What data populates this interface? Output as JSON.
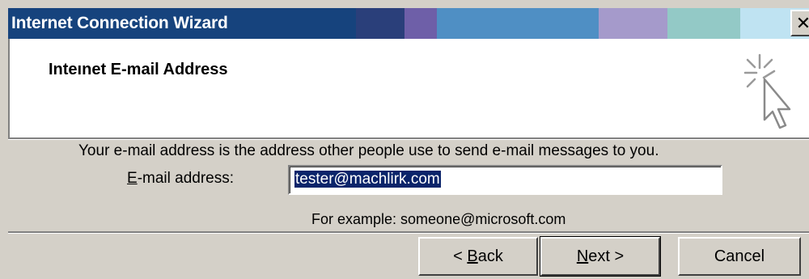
{
  "window": {
    "title": "Internet Connection Wizard",
    "close_glyph": "✕"
  },
  "header": {
    "page_title": "Inteınet E-mail Address",
    "graphic_icon": "wizard-sparkle-cursor-icon"
  },
  "body": {
    "description": "Your e-mail address is the address other people use to send e-mail messages to you.",
    "field_label_key": "E",
    "field_label_rest": "-mail address:",
    "email_value": "tester@machlirk.com",
    "example": "For example: someone@microsoft.com"
  },
  "buttons": {
    "back_prefix": "< ",
    "back_key": "B",
    "back_rest": "ack",
    "next_key": "N",
    "next_rest": "ext >",
    "cancel": "Cancel"
  },
  "colors": {
    "title_gradient": [
      "#0a2e6b",
      "#1c4f8e",
      "#7a6fb0",
      "#4a90c8",
      "#a89fd0",
      "#8fc8c8",
      "#b8e0f0"
    ],
    "selection": "#0a246a",
    "face": "#d4d0c8"
  }
}
